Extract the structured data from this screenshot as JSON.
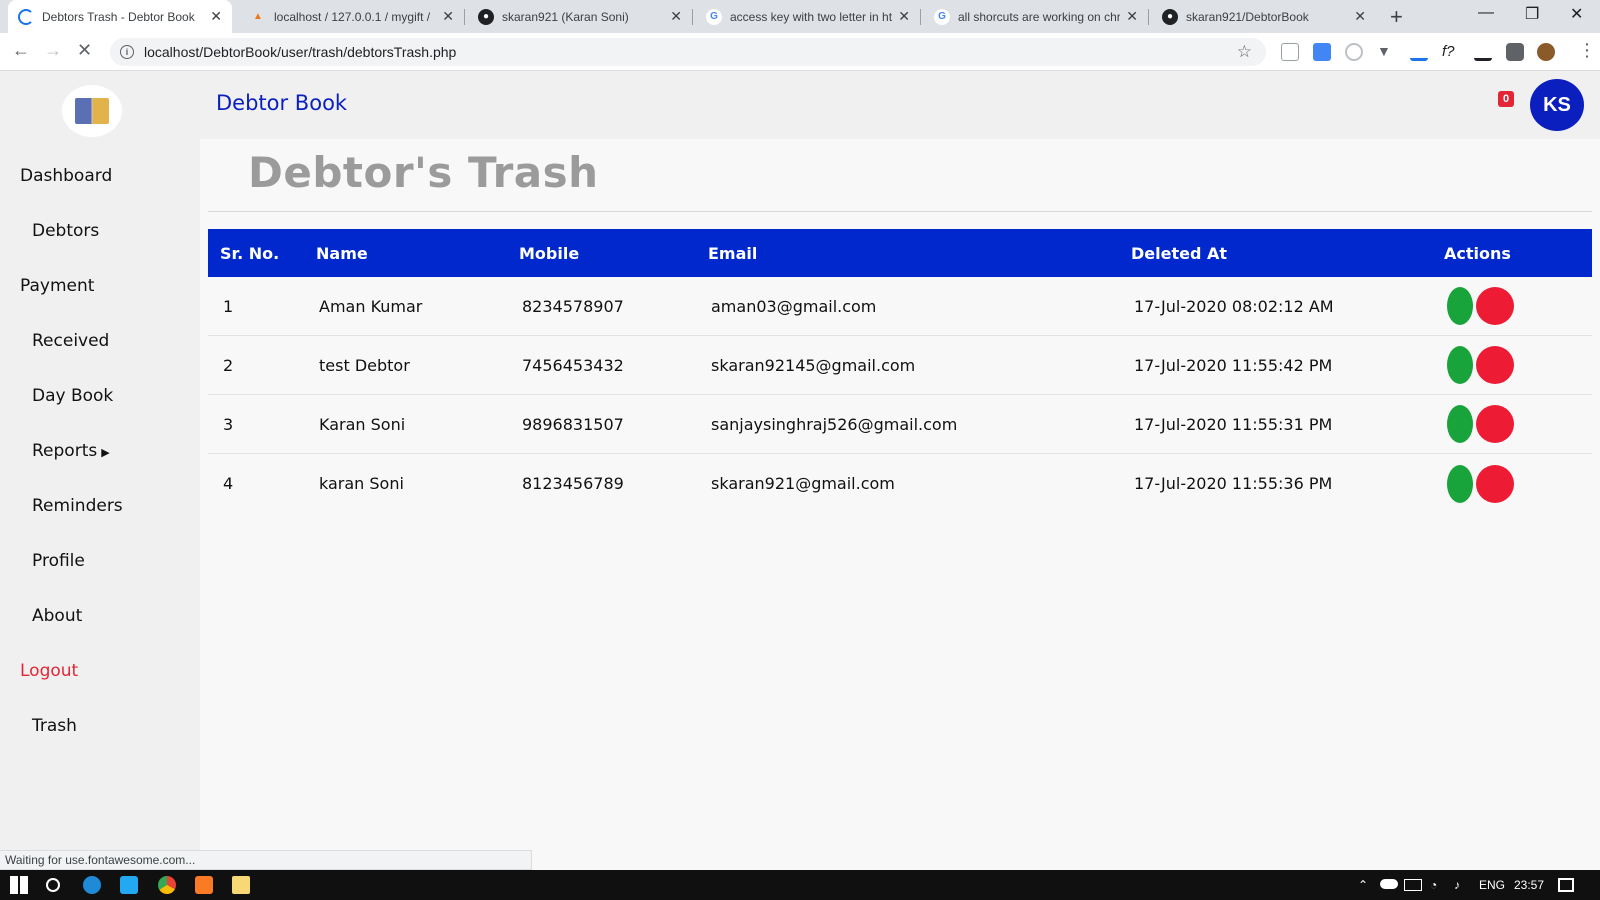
{
  "browser": {
    "tabs": [
      {
        "title": "Debtors Trash - Debtor Book",
        "active": true
      },
      {
        "title": "localhost / 127.0.0.1 / mygift / ",
        "active": false
      },
      {
        "title": "skaran921 (Karan Soni)",
        "active": false
      },
      {
        "title": "access key with two letter in ht",
        "active": false
      },
      {
        "title": "all shorcuts are working on chr",
        "active": false
      },
      {
        "title": "skaran921/DebtorBook",
        "active": false
      }
    ],
    "url": "localhost/DebtorBook/user/trash/debtorsTrash.php",
    "status_text": "Waiting for use.fontawesome.com..."
  },
  "app": {
    "brand": "Debtor Book",
    "notification_count": "0",
    "user_initials": "KS",
    "colors": {
      "primary": "#0028cc",
      "danger": "#ee1b35",
      "success": "#18a33b"
    }
  },
  "sidebar": {
    "items": [
      {
        "label": "Dashboard"
      },
      {
        "label": "Debtors"
      },
      {
        "label": "Payment"
      },
      {
        "label": "Received"
      },
      {
        "label": "Day Book"
      },
      {
        "label": "Reports"
      },
      {
        "label": "Reminders"
      },
      {
        "label": "Profile"
      },
      {
        "label": "About"
      },
      {
        "label": "Logout"
      },
      {
        "label": "Trash"
      }
    ]
  },
  "page": {
    "title": "Debtor's Trash",
    "table": {
      "headers": [
        "Sr. No.",
        "Name",
        "Mobile",
        "Email",
        "Deleted At",
        "Actions"
      ],
      "rows": [
        [
          "1",
          "Aman Kumar",
          "8234578907",
          "aman03@gmail.com",
          "17-Jul-2020 08:02:12 AM"
        ],
        [
          "2",
          "test Debtor",
          "7456453432",
          "skaran92145@gmail.com",
          "17-Jul-2020 11:55:42 PM"
        ],
        [
          "3",
          "Karan Soni",
          "9896831507",
          "sanjaysinghraj526@gmail.com",
          "17-Jul-2020 11:55:31 PM"
        ],
        [
          "4",
          "karan Soni",
          "8123456789",
          "skaran921@gmail.com",
          "17-Jul-2020 11:55:36 PM"
        ]
      ]
    }
  },
  "taskbar": {
    "language": "ENG",
    "time": "23:57"
  }
}
